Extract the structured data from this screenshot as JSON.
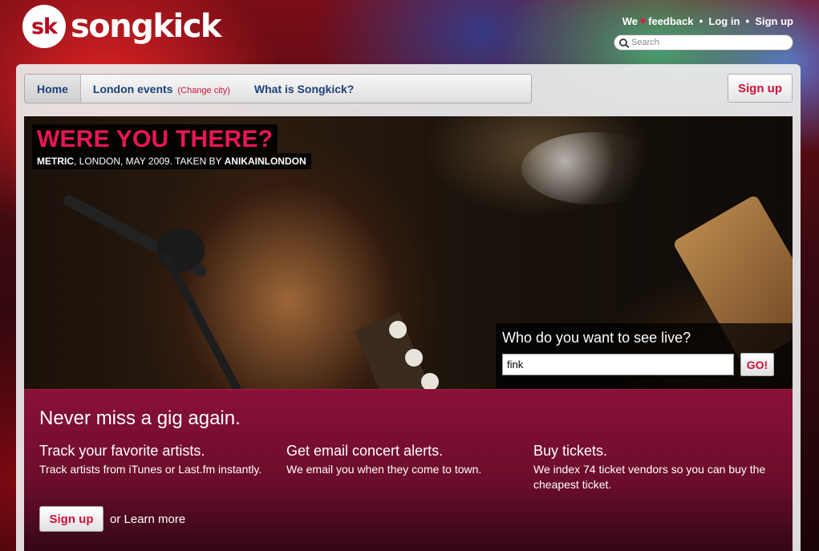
{
  "header": {
    "logo_badge": "sk",
    "logo_text": "songkick",
    "links": {
      "we_text": "We",
      "feedback_text": "feedback",
      "login": "Log in",
      "signup": "Sign up"
    },
    "search": {
      "placeholder": "Search"
    }
  },
  "nav": {
    "home": "Home",
    "london_events": "London events",
    "change_city": "(Change city)",
    "what_is": "What is Songkick?",
    "signup_button": "Sign up"
  },
  "hero": {
    "title": "WERE YOU THERE?",
    "caption_artist": "METRIC",
    "caption_middle": ", LONDON, MAY 2009. TAKEN BY ",
    "caption_author": "ANIKAINLONDON",
    "search_label": "Who do you want to see live?",
    "search_value": "fink",
    "go_label": "GO!"
  },
  "promo": {
    "heading": "Never miss a gig again.",
    "features": [
      {
        "title": "Track your favorite artists.",
        "text": "Track artists from iTunes or Last.fm instantly."
      },
      {
        "title": "Get email concert alerts.",
        "text": "We email you when they come to town."
      },
      {
        "title": "Buy tickets.",
        "text": "We index 74 ticket vendors so you can buy the cheapest ticket."
      }
    ],
    "signup_label": "Sign up",
    "learn_more": "or Learn more"
  },
  "colors": {
    "accent_pink": "#d0103a",
    "hero_title": "#ec1654",
    "nav_blue": "#1d3f7a",
    "promo_bg": "#6a0d2a"
  }
}
